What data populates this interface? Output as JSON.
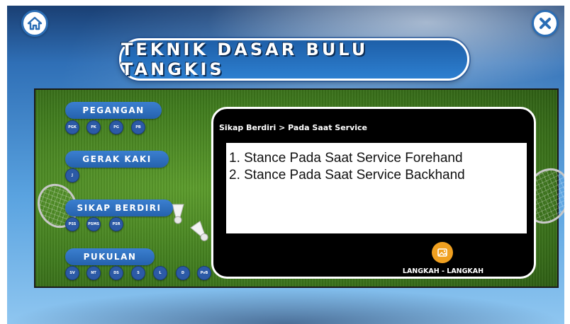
{
  "header": {
    "title": "TEKNIK DASAR BULU TANGKIS",
    "home_icon": "home-icon",
    "close_icon": "close-icon"
  },
  "menu": {
    "sections": [
      {
        "label": "PEGANGAN",
        "chips": [
          "PGK",
          "PK",
          "PG",
          "PB"
        ]
      },
      {
        "label": "GERAK KAKI",
        "chips": [
          "J"
        ]
      },
      {
        "label": "SIKAP BERDIRI",
        "chips": [
          "PSS",
          "PSMS",
          "PSR"
        ]
      },
      {
        "label": "PUKULAN",
        "chips": [
          "SV",
          "NT",
          "DS",
          "S",
          "L",
          "D",
          "PvB"
        ]
      }
    ]
  },
  "content": {
    "breadcrumb": "Sikap Berdiri > Pada Saat Service",
    "lines": [
      "1. Stance Pada Saat Service Forehand",
      "2. Stance Pada Saat Service Backhand"
    ],
    "steps_label": "LANGKAH - LANGKAH",
    "steps_icon": "folder-image-icon"
  },
  "colors": {
    "pill_blue": "#2c6bb8",
    "chip_blue": "#2c5aa6",
    "steps_orange": "#f0a020",
    "card_bg": "#000000",
    "grass": "#4a8a22"
  }
}
